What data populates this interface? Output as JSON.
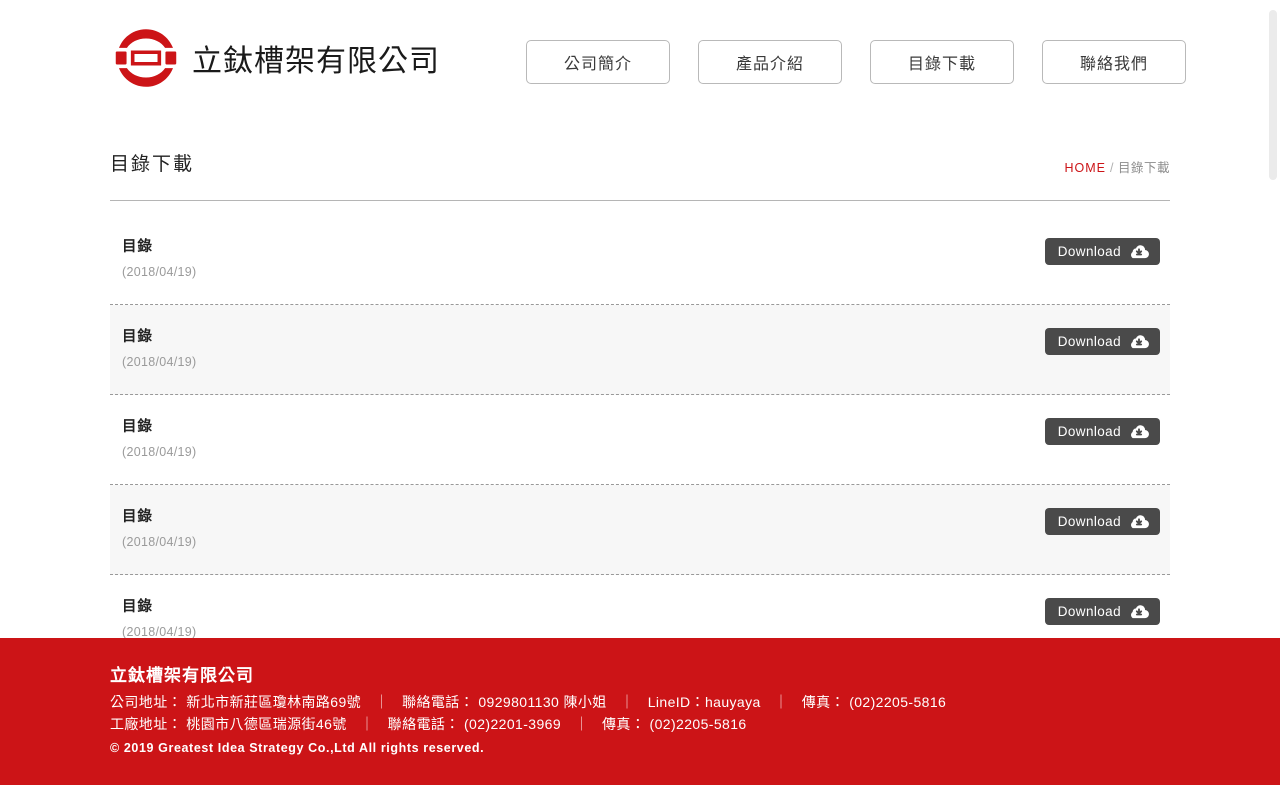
{
  "header": {
    "logo_icon": "company-emblem-icon",
    "brand_name": "立鈦槽架有限公司",
    "nav": [
      {
        "label": "公司簡介",
        "name": "nav-about"
      },
      {
        "label": "產品介紹",
        "name": "nav-products"
      },
      {
        "label": "目錄下載",
        "name": "nav-downloads"
      },
      {
        "label": "聯絡我們",
        "name": "nav-contact"
      }
    ]
  },
  "page": {
    "title": "目錄下載",
    "breadcrumb": {
      "home": "HOME",
      "separator": "/",
      "current": "目錄下載"
    }
  },
  "downloads": {
    "button_label": "Download",
    "button_icon": "cloud-download-icon",
    "items": [
      {
        "title": "目錄",
        "date": "(2018/04/19)"
      },
      {
        "title": "目錄",
        "date": "(2018/04/19)"
      },
      {
        "title": "目錄",
        "date": "(2018/04/19)"
      },
      {
        "title": "目錄",
        "date": "(2018/04/19)"
      },
      {
        "title": "目錄",
        "date": "(2018/04/19)"
      }
    ]
  },
  "footer": {
    "company": "立鈦槽架有限公司",
    "line1": {
      "address_label": "公司地址：",
      "address_value": "新北市新莊區瓊林南路69號",
      "phone_label": "聯絡電話：",
      "phone_value": "0929801130 陳小姐",
      "line_label": "LineID：hauyaya",
      "fax_label": "傳真：",
      "fax_value": "(02)2205-5816"
    },
    "line2": {
      "address_label": "工廠地址：",
      "address_value": "桃園市八德區瑞源街46號",
      "phone_label": "聯絡電話：",
      "phone_value": "(02)2201-3969",
      "fax_label": "傳真：",
      "fax_value": "(02)2205-5816"
    },
    "copyright": "© 2019 Greatest Idea Strategy Co.,Ltd All rights reserved.",
    "separator": "｜"
  },
  "colors": {
    "brand_red": "#CC1417",
    "button_dark": "#4A4A4A",
    "row_alt": "#F7F7F7",
    "text_dark": "#222222",
    "text_muted": "#9A9A9A"
  }
}
